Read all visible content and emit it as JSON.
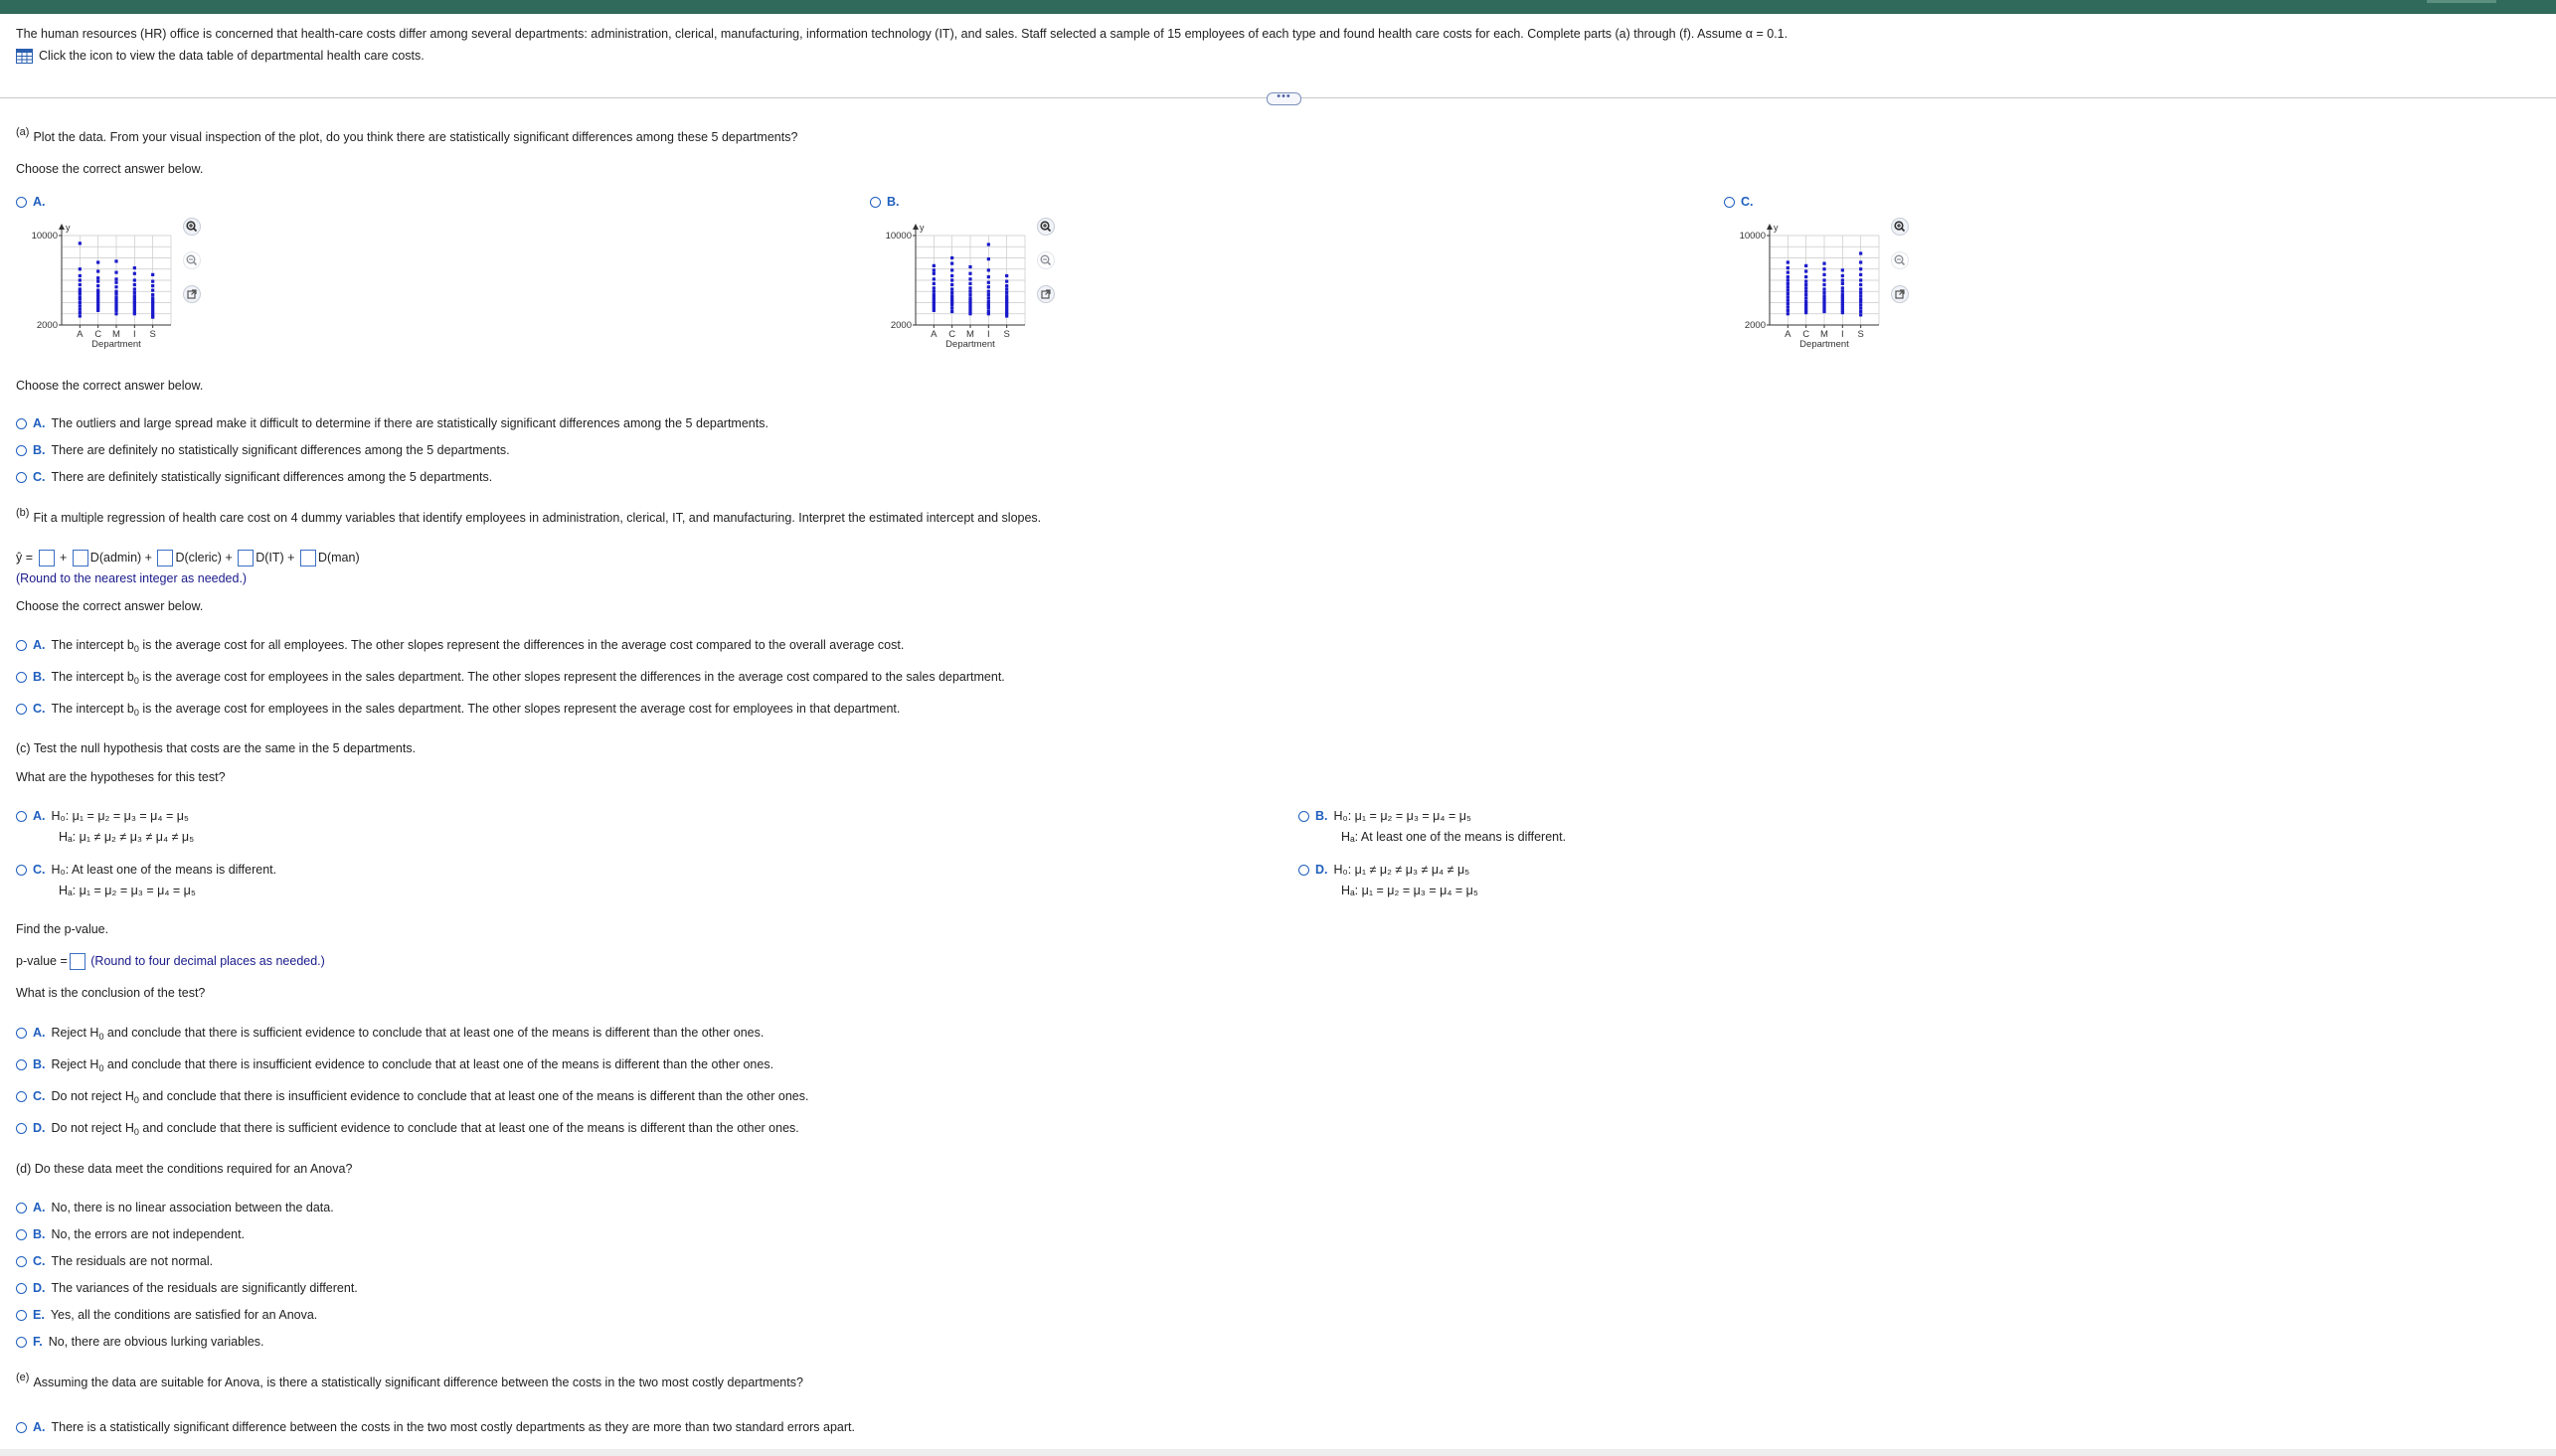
{
  "intro": "The human resources (HR) office is concerned that health-care costs differ among several departments: administration, clerical, manufacturing, information technology (IT), and sales. Staff selected a sample of 15 employees of each type and found health care costs for each. Complete parts (a) through (f). Assume α = 0.1.",
  "data_link": "Click the icon to view the data table of departmental health care costs.",
  "more_label": "•••",
  "a": {
    "label": "(a)",
    "question": "Plot the data. From your visual inspection of the plot, do you think there are statistically significant differences among these 5 departments?",
    "choose1": "Choose the correct answer below.",
    "chart_options": [
      {
        "letter": "A."
      },
      {
        "letter": "B."
      },
      {
        "letter": "C."
      }
    ],
    "choose2": "Choose the correct answer below.",
    "options": [
      {
        "letter": "A.",
        "text": "The outliers and large spread make it difficult to determine if there are statistically significant differences among the 5 departments."
      },
      {
        "letter": "B.",
        "text": "There are definitely no statistically significant differences among the 5 departments."
      },
      {
        "letter": "C.",
        "text": "There are definitely statistically significant differences among the 5 departments."
      }
    ]
  },
  "b": {
    "label": "(b)",
    "question": "Fit a multiple regression of health care cost on 4 dummy variables that identify employees in administration, clerical, IT, and manufacturing. Interpret the estimated intercept and slopes.",
    "eq_yhat": "ŷ =",
    "eq_plus": "+",
    "eq_terms": [
      "D(admin) +",
      "D(cleric) +",
      "D(IT) +",
      "D(man)"
    ],
    "round_note": "(Round to the nearest integer as needed.)",
    "choose": "Choose the correct answer below.",
    "options": [
      {
        "letter": "A.",
        "pre": "The intercept b",
        "sub": "0",
        "post": " is the average cost for all employees. The other slopes represent the differences in the average cost compared to the overall average cost."
      },
      {
        "letter": "B.",
        "pre": "The intercept b",
        "sub": "0",
        "post": " is the average cost for employees in the sales department. The other slopes represent the differences in the average cost compared to the sales department."
      },
      {
        "letter": "C.",
        "pre": "The intercept b",
        "sub": "0",
        "post": " is the average cost for employees in the sales department. The other slopes represent the average cost for employees in that department."
      }
    ]
  },
  "c": {
    "question": "(c) Test the null hypothesis that costs are the same in the 5 departments.",
    "hyp_q": "What are the hypotheses for this test?",
    "hyp_options": [
      {
        "letter": "A.",
        "l1": "H₀: μ₁ = μ₂ = μ₃ = μ₄ = μ₅",
        "l2": "Hₐ: μ₁ ≠ μ₂ ≠ μ₃ ≠ μ₄ ≠ μ₅"
      },
      {
        "letter": "B.",
        "l1": "H₀: μ₁ = μ₂ = μ₃ = μ₄ = μ₅",
        "l2": "Hₐ: At least one of the means is different."
      },
      {
        "letter": "C.",
        "l1": "H₀: At least one of the means is different.",
        "l2": "Hₐ: μ₁ = μ₂ = μ₃ = μ₄ = μ₅"
      },
      {
        "letter": "D.",
        "l1": "H₀: μ₁ ≠ μ₂ ≠ μ₃ ≠ μ₄ ≠ μ₅",
        "l2": "Hₐ: μ₁ = μ₂ = μ₃ = μ₄ = μ₅"
      }
    ],
    "pvalue_q": "Find the p-value.",
    "pvalue_label": "p-value =",
    "pvalue_note": "(Round to four decimal places as needed.)",
    "concl_q": "What is the conclusion of the test?",
    "concl_options": [
      {
        "letter": "A.",
        "pre": "Reject H",
        "sub": "0",
        "post": " and conclude that there is sufficient evidence to conclude that at least one of the means is different than the other ones."
      },
      {
        "letter": "B.",
        "pre": "Reject H",
        "sub": "0",
        "post": " and conclude that there is insufficient evidence to conclude that at least one of the means is different than the other ones."
      },
      {
        "letter": "C.",
        "pre": "Do not reject H",
        "sub": "0",
        "post": " and conclude that there is insufficient evidence to conclude that at least one of the means is different than the other ones."
      },
      {
        "letter": "D.",
        "pre": "Do not reject H",
        "sub": "0",
        "post": " and conclude that there is sufficient evidence to conclude that at least one of the means is different than the other ones."
      }
    ]
  },
  "d": {
    "question": "(d) Do these data meet the conditions required for an Anova?",
    "options": [
      {
        "letter": "A.",
        "text": "No, there is no linear association between the data."
      },
      {
        "letter": "B.",
        "text": "No, the errors are not independent."
      },
      {
        "letter": "C.",
        "text": "The residuals are not normal."
      },
      {
        "letter": "D.",
        "text": "The variances of the residuals are significantly different."
      },
      {
        "letter": "E.",
        "text": "Yes, all the conditions are satisfied for an Anova."
      },
      {
        "letter": "F.",
        "text": "No, there are obvious lurking variables."
      }
    ]
  },
  "e": {
    "label": "(e)",
    "question": "Assuming the data are suitable for Anova, is there a statistically significant difference between the costs in the two most costly departments?",
    "options": [
      {
        "letter": "A.",
        "text": "There is a statistically significant difference between the costs in the two most costly departments as they are more than two standard errors apart."
      }
    ]
  },
  "chart_data": [
    {
      "type": "scatter",
      "xlabel": "Department",
      "ylabel": "y",
      "categories": [
        "A",
        "C",
        "M",
        "I",
        "S"
      ],
      "ylim": [
        2000,
        10000
      ],
      "yticks": [
        2000,
        10000
      ],
      "series": [
        {
          "values": [
            [
              9300,
              7000,
              6400,
              6000,
              5600,
              5200,
              5000,
              4800,
              4500,
              4300,
              4000,
              3700,
              3400,
              3100,
              2800
            ],
            [
              7600,
              6800,
              6200,
              5900,
              5500,
              5100,
              4900,
              4700,
              4500,
              4300,
              4100,
              3900,
              3700,
              3500,
              3300
            ],
            [
              7700,
              6700,
              6100,
              5800,
              5400,
              5000,
              4800,
              4500,
              4300,
              4100,
              3900,
              3700,
              3500,
              3300,
              3000
            ],
            [
              7100,
              6600,
              6000,
              5600,
              5200,
              4900,
              4600,
              4400,
              4200,
              4000,
              3800,
              3600,
              3400,
              3200,
              3000
            ],
            [
              6500,
              5900,
              5500,
              5100,
              4700,
              4400,
              4200,
              4000,
              3800,
              3600,
              3400,
              3200,
              3000,
              2800,
              2700
            ]
          ]
        }
      ]
    },
    {
      "type": "scatter",
      "xlabel": "Department",
      "ylabel": "y",
      "categories": [
        "A",
        "C",
        "M",
        "I",
        "S"
      ],
      "ylim": [
        2000,
        10000
      ],
      "yticks": [
        2000,
        10000
      ],
      "series": [
        {
          "values": [
            [
              7300,
              6900,
              6600,
              6100,
              5700,
              5300,
              5000,
              4700,
              4500,
              4300,
              4100,
              3900,
              3700,
              3500,
              3300
            ],
            [
              8000,
              7500,
              6900,
              6400,
              6000,
              5600,
              5200,
              4900,
              4600,
              4400,
              4200,
              4000,
              3800,
              3500,
              3200
            ],
            [
              7200,
              6600,
              6100,
              5700,
              5300,
              5000,
              4700,
              4400,
              4200,
              4000,
              3800,
              3600,
              3400,
              3200,
              3000
            ],
            [
              9200,
              7900,
              6900,
              6300,
              5800,
              5400,
              5000,
              4700,
              4400,
              4100,
              3900,
              3700,
              3500,
              3200,
              3000
            ],
            [
              6400,
              5900,
              5500,
              5200,
              4900,
              4600,
              4400,
              4200,
              4000,
              3800,
              3600,
              3400,
              3200,
              3000,
              2800
            ]
          ]
        }
      ]
    },
    {
      "type": "scatter",
      "xlabel": "Department",
      "ylabel": "y",
      "categories": [
        "A",
        "C",
        "M",
        "I",
        "S"
      ],
      "ylim": [
        2000,
        10000
      ],
      "yticks": [
        2000,
        10000
      ],
      "series": [
        {
          "values": [
            [
              7600,
              7100,
              6700,
              6300,
              6000,
              5700,
              5400,
              5100,
              4800,
              4500,
              4200,
              3900,
              3600,
              3300,
              3000
            ],
            [
              7300,
              6800,
              6300,
              5900,
              5600,
              5300,
              5000,
              4700,
              4400,
              4100,
              3900,
              3700,
              3500,
              3300,
              3100
            ],
            [
              7500,
              7000,
              6500,
              6000,
              5600,
              5200,
              4900,
              4600,
              4400,
              4200,
              4000,
              3800,
              3600,
              3400,
              3200
            ],
            [
              6900,
              6400,
              6000,
              5700,
              5300,
              5000,
              4700,
              4500,
              4300,
              4100,
              3900,
              3700,
              3500,
              3300,
              3100
            ],
            [
              8400,
              7600,
              7000,
              6500,
              6000,
              5600,
              5200,
              4900,
              4600,
              4300,
              4100,
              3800,
              3500,
              3200,
              2900
            ]
          ]
        }
      ]
    }
  ],
  "colors": {
    "accent": "#1f5fbf",
    "header": "#2f6a5a",
    "point": "#1a1acc",
    "text_blue": "#1a1a8c"
  }
}
